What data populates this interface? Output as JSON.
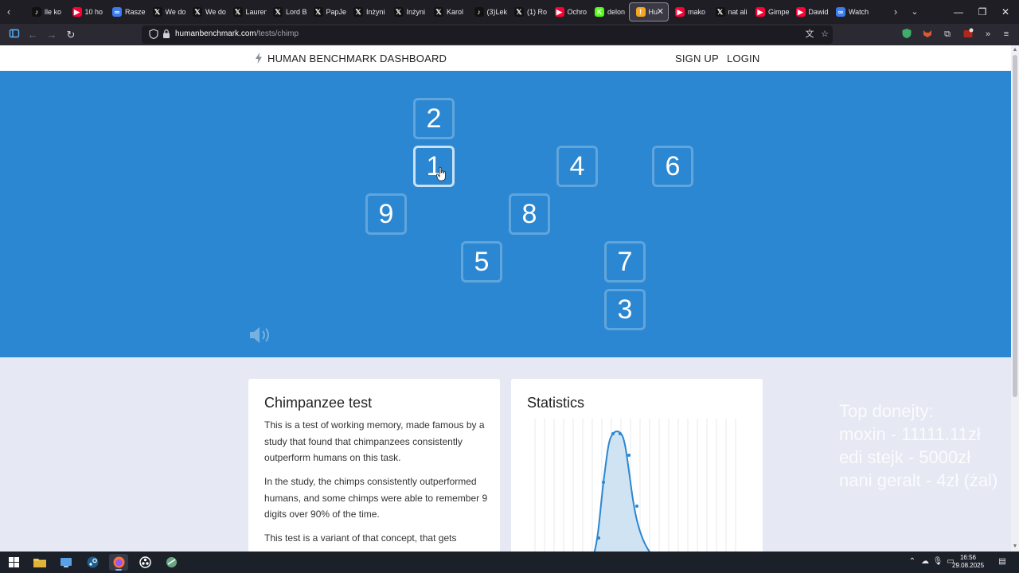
{
  "browser": {
    "tabs": [
      {
        "label": "lle ko",
        "icon": "tiktok-icon",
        "color": "#111111",
        "glyph": "♪"
      },
      {
        "label": "10 ho",
        "icon": "youtube-icon",
        "color": "#ff0033",
        "glyph": "▶"
      },
      {
        "label": "Rasze",
        "icon": "copilot-icon",
        "color": "#3b7cf0",
        "glyph": "∞"
      },
      {
        "label": "We do",
        "icon": "x-icon",
        "color": "#111111",
        "glyph": "𝕏"
      },
      {
        "label": "We do",
        "icon": "x-icon",
        "color": "#111111",
        "glyph": "𝕏"
      },
      {
        "label": "Lauren",
        "icon": "x-icon",
        "color": "#111111",
        "glyph": "𝕏"
      },
      {
        "label": "Lord B",
        "icon": "x-icon",
        "color": "#111111",
        "glyph": "𝕏"
      },
      {
        "label": "PapJe",
        "icon": "x-icon",
        "color": "#111111",
        "glyph": "𝕏"
      },
      {
        "label": "Inżyni",
        "icon": "x-icon",
        "color": "#111111",
        "glyph": "𝕏"
      },
      {
        "label": "Inżyni",
        "icon": "x-icon",
        "color": "#111111",
        "glyph": "𝕏"
      },
      {
        "label": "Karol",
        "icon": "x-icon",
        "color": "#111111",
        "glyph": "𝕏"
      },
      {
        "label": "(3)Lek",
        "icon": "tiktok-icon",
        "color": "#111111",
        "glyph": "♪"
      },
      {
        "label": "(1) Ro",
        "icon": "x-icon",
        "color": "#111111",
        "glyph": "𝕏"
      },
      {
        "label": "Ochro",
        "icon": "youtube-icon",
        "color": "#ff0033",
        "glyph": "▶"
      },
      {
        "label": "delon",
        "icon": "kick-icon",
        "color": "#53fc18",
        "glyph": "K"
      },
      {
        "label": "Hu",
        "icon": "humanbenchmark-icon",
        "color": "#f5a623",
        "glyph": "!",
        "active": true
      },
      {
        "label": "mako",
        "icon": "youtube-icon",
        "color": "#ff0033",
        "glyph": "▶"
      },
      {
        "label": "nat ali",
        "icon": "x-icon",
        "color": "#111111",
        "glyph": "𝕏"
      },
      {
        "label": "Gimpe",
        "icon": "youtube-icon",
        "color": "#ff0033",
        "glyph": "▶"
      },
      {
        "label": "Dawid",
        "icon": "youtube-icon",
        "color": "#ff0033",
        "glyph": "▶"
      },
      {
        "label": "Watch",
        "icon": "copilot-icon",
        "color": "#3b7cf0",
        "glyph": "∞"
      }
    ],
    "url_host": "humanbenchmark.com",
    "url_path": "/tests/chimp"
  },
  "site": {
    "brand": "HUMAN BENCHMARK",
    "dashboard": "DASHBOARD",
    "signup": "SIGN UP",
    "login": "LOGIN"
  },
  "game": {
    "tiles": [
      {
        "n": "2"
      },
      {
        "n": "1",
        "highlight": true
      },
      {
        "n": "4"
      },
      {
        "n": "6"
      },
      {
        "n": "9"
      },
      {
        "n": "8"
      },
      {
        "n": "5"
      },
      {
        "n": "7"
      },
      {
        "n": "3"
      }
    ],
    "accent": "#2b87d1"
  },
  "info_card": {
    "title": "Chimpanzee test",
    "p1": "This is a test of working memory, made famous by a study that found that chimpanzees consistently outperform humans on this task.",
    "p2": "In the study, the chimps consistently outperformed humans, and some chimps were able to remember 9 digits over 90% of the time.",
    "p3": "This test is a variant of that concept, that gets"
  },
  "stats_card": {
    "title": "Statistics"
  },
  "overlay": {
    "l1": "Top donejty:",
    "l2": "moxin - 11111.11zł",
    "l3": "edi stejk - 5000zł",
    "l4": "nani geralt - 4zł (żal)"
  },
  "taskbar": {
    "time": "16:56",
    "date": "29.08.2025"
  }
}
